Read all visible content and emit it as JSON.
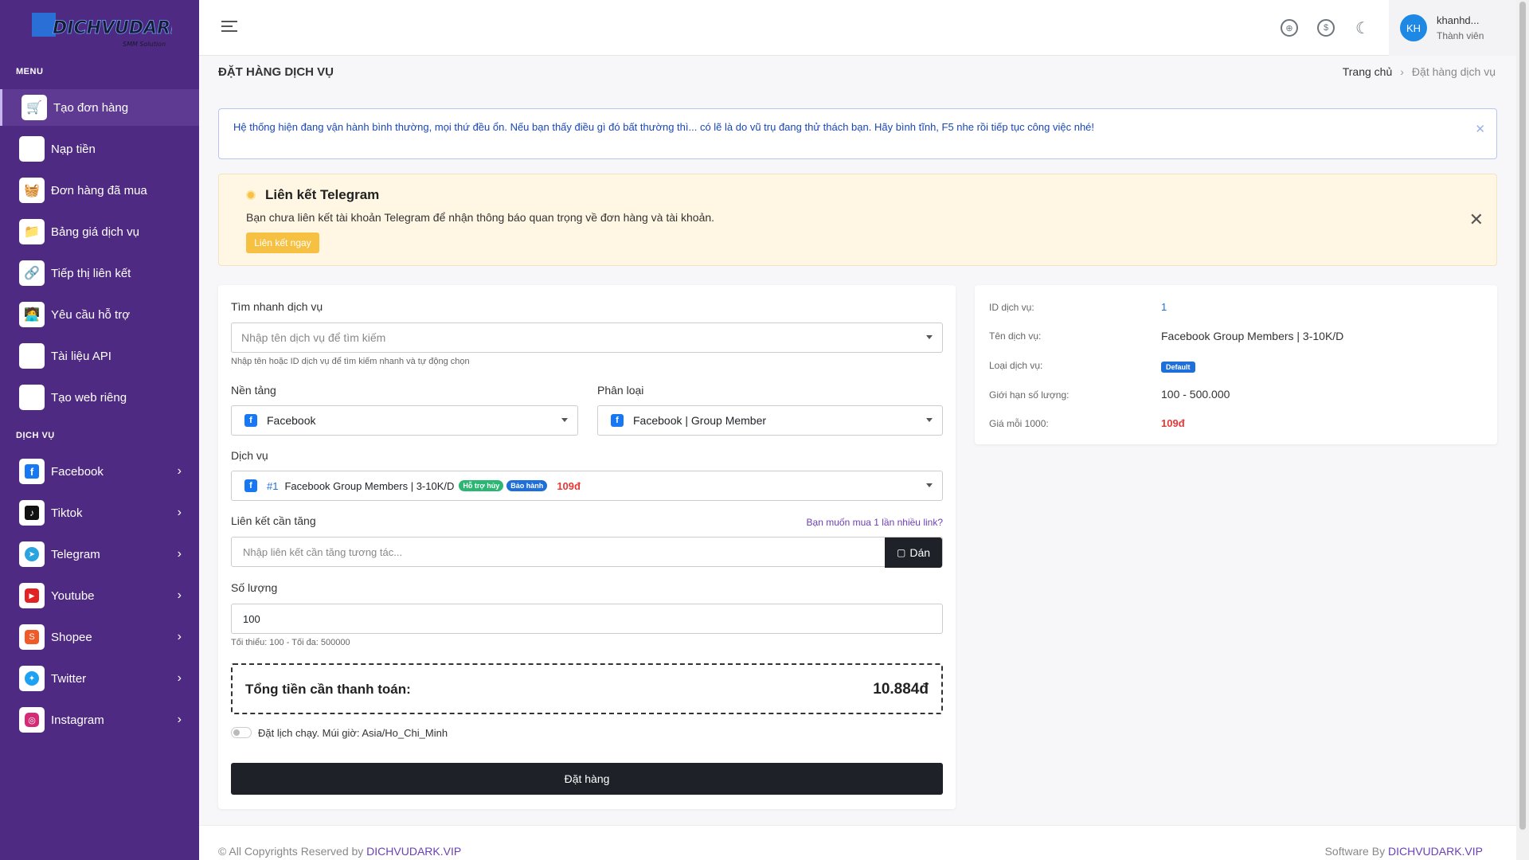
{
  "sidebar": {
    "logo_text": "DICHVUDARK.VIP",
    "menu_title": "MENU",
    "menu_items": [
      {
        "label": "Tạo đơn hàng",
        "icon": "cart-icon"
      },
      {
        "label": "Nạp tiền",
        "icon": "bank-icon"
      },
      {
        "label": "Đơn hàng đã mua",
        "icon": "basket-icon"
      },
      {
        "label": "Bảng giá dịch vụ",
        "icon": "folder-icon"
      },
      {
        "label": "Tiếp thị liên kết",
        "icon": "link-icon"
      },
      {
        "label": "Yêu cầu hỗ trợ",
        "icon": "support-icon"
      },
      {
        "label": "Tài liệu API",
        "icon": "api-icon"
      },
      {
        "label": "Tạo web riêng",
        "icon": "terminal-icon"
      }
    ],
    "service_title": "DỊCH VỤ",
    "service_items": [
      {
        "label": "Facebook",
        "icon": "facebook-icon"
      },
      {
        "label": "Tiktok",
        "icon": "tiktok-icon"
      },
      {
        "label": "Telegram",
        "icon": "telegram-icon"
      },
      {
        "label": "Youtube",
        "icon": "youtube-icon"
      },
      {
        "label": "Shopee",
        "icon": "shopee-icon"
      },
      {
        "label": "Twitter",
        "icon": "twitter-icon"
      },
      {
        "label": "Instagram",
        "icon": "instagram-icon"
      }
    ]
  },
  "header": {
    "user_initials": "KH",
    "user_name": "khanhd...",
    "user_role": "Thành viên"
  },
  "page": {
    "title": "ĐẶT HÀNG DỊCH VỤ",
    "breadcrumb_home": "Trang chủ",
    "breadcrumb_current": "Đặt hàng dịch vụ"
  },
  "alert": {
    "text": "Hệ thống hiện đang vận hành bình thường, mọi thứ đều ổn. Nếu bạn thấy điều gì đó bất thường thì... có lẽ là do vũ trụ đang thử thách bạn. Hãy bình tĩnh, F5 nhe rồi tiếp tục công việc nhé!"
  },
  "telegram": {
    "title": "Liên kết Telegram",
    "desc": "Bạn chưa liên kết tài khoản Telegram để nhận thông báo quan trọng về đơn hàng và tài khoản.",
    "button": "Liên kết ngay"
  },
  "form": {
    "search_label": "Tìm nhanh dịch vụ",
    "search_placeholder": "Nhập tên dịch vụ để tìm kiếm",
    "search_hint": "Nhập tên hoặc ID dịch vụ để tìm kiếm nhanh và tự động chọn",
    "platform_label": "Nền tảng",
    "platform_value": "Facebook",
    "category_label": "Phân loại",
    "category_value": "Facebook | Group Member",
    "service_label": "Dịch vụ",
    "service_id": "#1",
    "service_name": "Facebook Group Members | 3-10K/D",
    "badge_cancel": "Hỗ trợ hủy",
    "badge_warranty": "Bảo hành",
    "service_price": "109đ",
    "link_label": "Liên kết cần tăng",
    "link_multi": "Bạn muốn mua 1 lần nhiều link?",
    "link_placeholder": "Nhập liên kết cần tăng tương tác...",
    "paste_label": "Dán",
    "qty_label": "Số lượng",
    "qty_value": "100",
    "qty_hint": "Tối thiểu: 100 - Tối đa: 500000",
    "total_label": "Tổng tiền cần thanh toán:",
    "total_value": "10.884đ",
    "schedule_label": "Đặt lịch chạy. Múi giờ: Asia/Ho_Chi_Minh",
    "order_button": "Đặt hàng"
  },
  "info": {
    "id_label": "ID dịch vụ:",
    "id_value": "1",
    "name_label": "Tên dịch vụ:",
    "name_value": "Facebook Group Members | 3-10K/D",
    "type_label": "Loại dịch vụ:",
    "type_value": "Default",
    "limit_label": "Giới hạn số lượng:",
    "limit_value": "100 - 500.000",
    "price_label": "Giá mỗi 1000:",
    "price_value": "109đ"
  },
  "footer": {
    "left_prefix": "© All Copyrights Reserved by",
    "left_link": "DICHVUDARK.VIP",
    "right_prefix": "Software By",
    "right_link": "DICHVUDARK.VIP"
  },
  "colors": {
    "sidebar": "#4f2a82",
    "accent": "#6b3fb5",
    "price": "#e53935"
  }
}
